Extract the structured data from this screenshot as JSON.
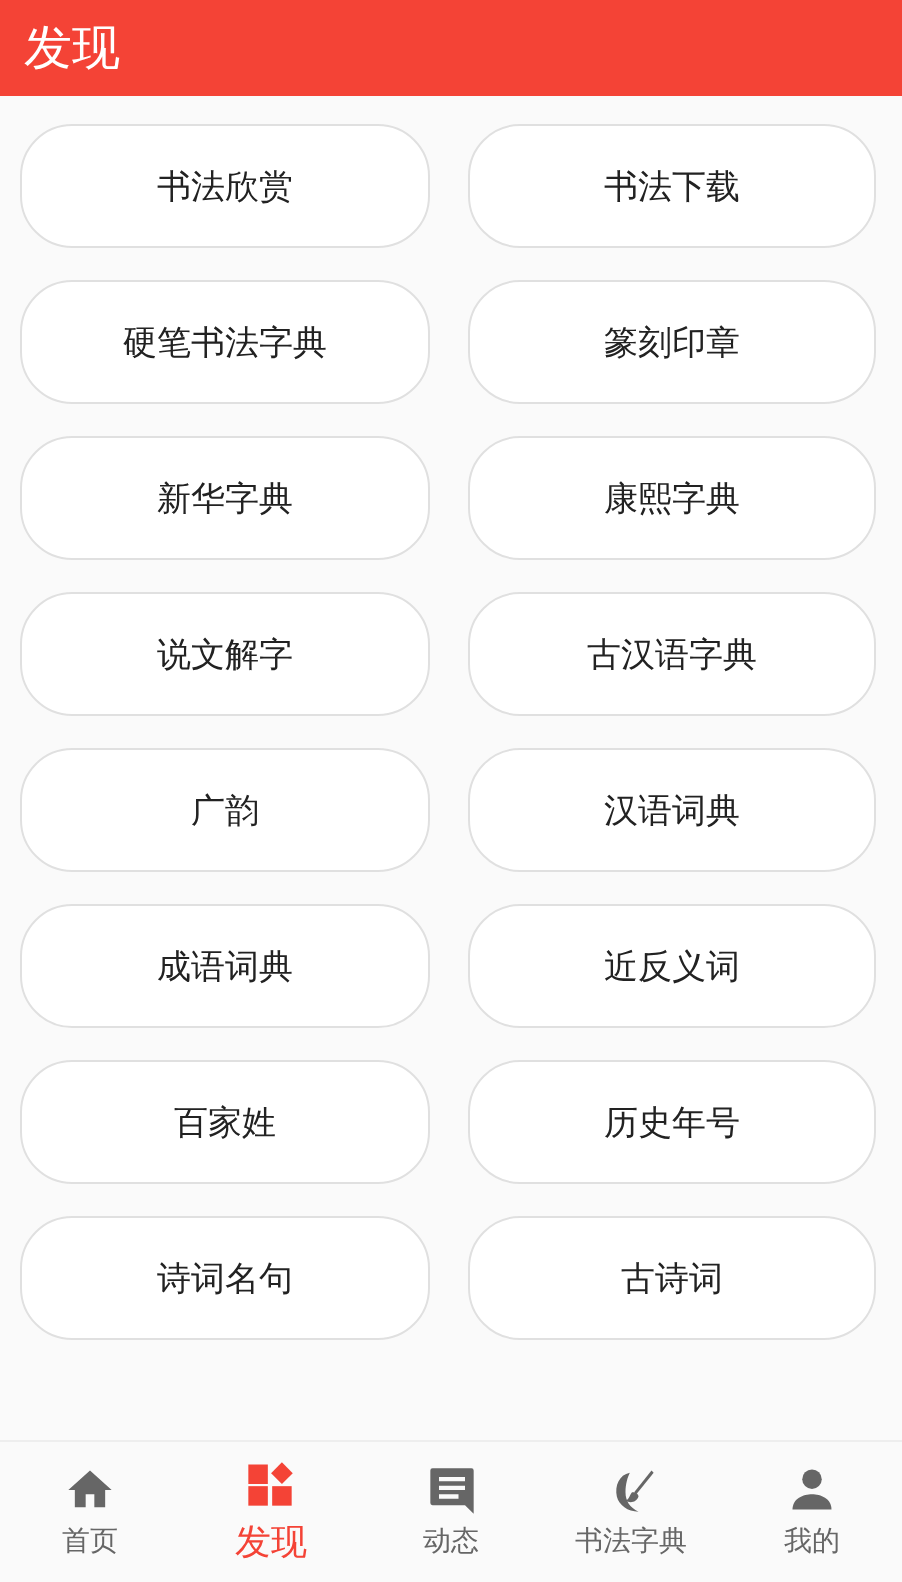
{
  "header": {
    "title": "发现"
  },
  "items": [
    "书法欣赏",
    "书法下载",
    "硬笔书法字典",
    "篆刻印章",
    "新华字典",
    "康熙字典",
    "说文解字",
    "古汉语字典",
    "广韵",
    "汉语词典",
    "成语词典",
    "近反义词",
    "百家姓",
    "历史年号",
    "诗词名句",
    "古诗词"
  ],
  "nav": [
    {
      "label": "首页",
      "selected": false
    },
    {
      "label": "发现",
      "selected": true
    },
    {
      "label": "动态",
      "selected": false
    },
    {
      "label": "书法字典",
      "selected": false
    },
    {
      "label": "我的",
      "selected": false
    }
  ]
}
